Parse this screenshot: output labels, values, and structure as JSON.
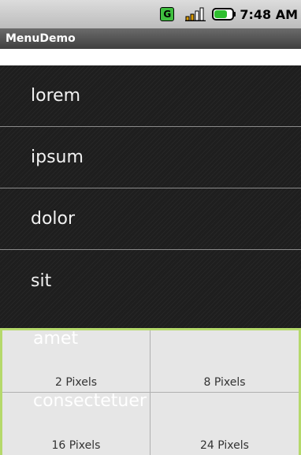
{
  "status_bar": {
    "time": "7:48 AM",
    "network_badge": "G",
    "icons": [
      "g-network-icon",
      "signal-strength-icon",
      "battery-icon"
    ]
  },
  "title_bar": {
    "title": "MenuDemo"
  },
  "list": {
    "items": [
      "lorem",
      "ipsum",
      "dolor",
      "sit"
    ],
    "below_menu_items": [
      "amet",
      "consectetuer"
    ]
  },
  "options_menu": {
    "items": [
      "2 Pixels",
      "8 Pixels",
      "16 Pixels",
      "24 Pixels"
    ]
  },
  "colors": {
    "list_background": "#1e1e1e",
    "menu_background": "#e6e6e6",
    "menu_border": "#b5d96b",
    "battery_fill": "#2fbf2f"
  }
}
